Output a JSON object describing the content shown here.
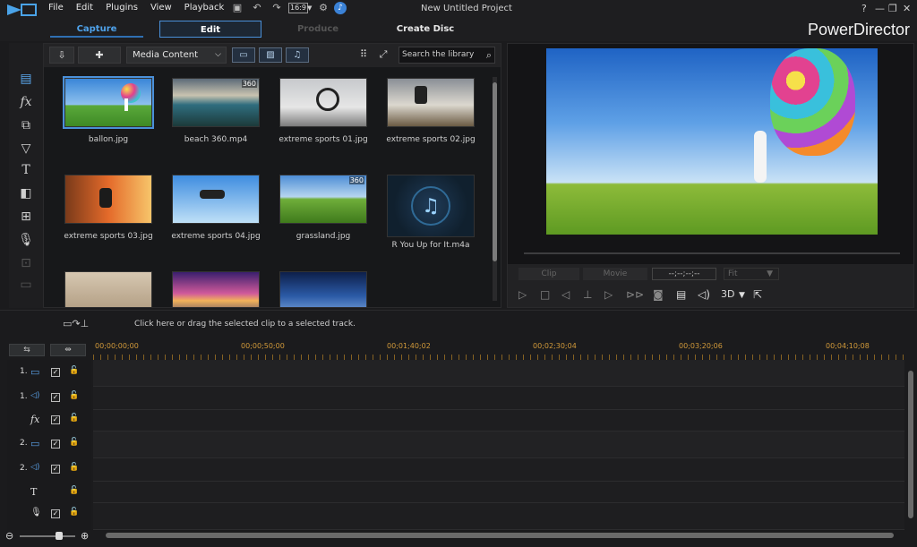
{
  "menu": [
    "File",
    "Edit",
    "Plugins",
    "View",
    "Playback"
  ],
  "ratio": "16:9",
  "project_title": "New Untitled Project",
  "window_controls": [
    "?",
    "—",
    "❐",
    "✕"
  ],
  "modes": {
    "capture": "Capture",
    "edit": "Edit",
    "produce": "Produce",
    "create_disc": "Create Disc"
  },
  "brand": "PowerDirector",
  "library": {
    "dropdown": "Media Content",
    "search_placeholder": "Search the library",
    "items": [
      {
        "label": "ballon.jpg",
        "badge": ""
      },
      {
        "label": "beach 360.mp4",
        "badge": "360"
      },
      {
        "label": "extreme sports 01.jpg",
        "badge": ""
      },
      {
        "label": "extreme sports 02.jpg",
        "badge": ""
      },
      {
        "label": "extreme sports 03.jpg",
        "badge": ""
      },
      {
        "label": "extreme sports 04.jpg",
        "badge": ""
      },
      {
        "label": "grassland.jpg",
        "badge": "360"
      },
      {
        "label": "R You Up for It.m4a",
        "badge": ""
      }
    ]
  },
  "preview": {
    "clip_label": "Clip",
    "movie_label": "Movie",
    "timecode": "--;--;--;--",
    "fit": "Fit",
    "mode_3d": "3D"
  },
  "instruction": "Click here or drag the selected clip to a selected track.",
  "timeline": {
    "ruler": [
      "00;00;00;00",
      "00;00;50;00",
      "00;01;40;02",
      "00;02;30;04",
      "00;03;20;06",
      "00;04;10;08"
    ],
    "tracks": [
      {
        "num": "1.",
        "icon": "▭",
        "checked": true
      },
      {
        "num": "1.",
        "icon": "◁)",
        "checked": true
      },
      {
        "num": "",
        "icon": "fx",
        "checked": true
      },
      {
        "num": "2.",
        "icon": "▭",
        "checked": true
      },
      {
        "num": "2.",
        "icon": "◁)",
        "checked": true
      },
      {
        "num": "",
        "icon": "T",
        "checked": false
      },
      {
        "num": "",
        "icon": "🎙",
        "checked": true
      }
    ]
  },
  "colors": {
    "accent": "#4a90d9",
    "ruler": "#d29a3a",
    "background": "#1b1b1d"
  }
}
